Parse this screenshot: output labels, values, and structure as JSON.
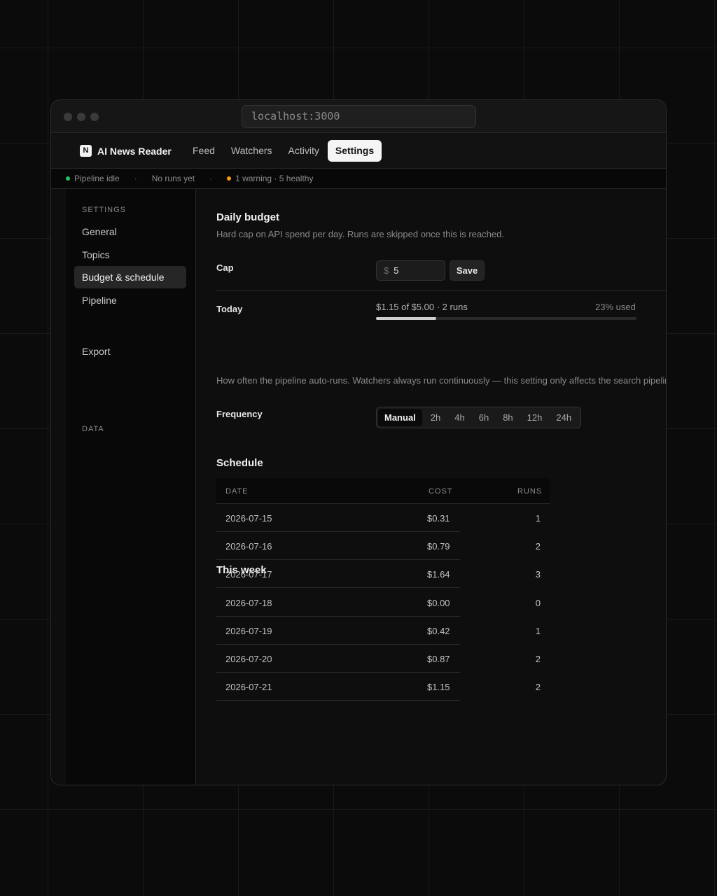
{
  "browser": {
    "url": "localhost:3000"
  },
  "app": {
    "name": "AI News Reader",
    "logo_letter": "N",
    "nav": [
      {
        "label": "Feed",
        "active": false
      },
      {
        "label": "Watchers",
        "active": false
      },
      {
        "label": "Activity",
        "active": false
      },
      {
        "label": "Settings",
        "active": true
      }
    ]
  },
  "status": {
    "pipeline": "Pipeline idle",
    "runs": "No runs yet",
    "health": "1 warning · 5 healthy",
    "colors": {
      "pipeline": "#22c55e",
      "health": "#f59e0b"
    }
  },
  "sidebar": {
    "section1": "SETTINGS",
    "items1": [
      "General",
      "Topics",
      "Budget & schedule",
      "Pipeline"
    ],
    "active_item": "Budget & schedule",
    "section2": "DATA",
    "items2": [
      "Export"
    ]
  },
  "budget": {
    "title": "Daily budget",
    "description": "Hard cap on API spend per day. Runs are skipped once this is reached.",
    "cap_label": "Cap",
    "currency": "$",
    "cap_value": "5",
    "save_label": "Save",
    "today_label": "Today",
    "today_text": "$1.15 of $5.00 · 2 runs",
    "used_text": "23% used",
    "used_fraction": 0.23
  },
  "schedule": {
    "title": "Schedule",
    "description": "How often the pipeline auto-runs. Watchers always run continuously — this setting only affects the search pipeline.",
    "frequency_label": "Frequency",
    "options": [
      "Manual",
      "2h",
      "4h",
      "6h",
      "8h",
      "12h",
      "24h"
    ],
    "selected": "Manual"
  },
  "week": {
    "title": "This week",
    "columns": [
      "DATE",
      "COST",
      "RUNS"
    ],
    "rows": [
      {
        "date": "2026-07-15",
        "cost": "$0.31",
        "runs": "1"
      },
      {
        "date": "2026-07-16",
        "cost": "$0.79",
        "runs": "2"
      },
      {
        "date": "2026-07-17",
        "cost": "$1.64",
        "runs": "3"
      },
      {
        "date": "2026-07-18",
        "cost": "$0.00",
        "runs": "0"
      },
      {
        "date": "2026-07-19",
        "cost": "$0.42",
        "runs": "1"
      },
      {
        "date": "2026-07-20",
        "cost": "$0.87",
        "runs": "2"
      },
      {
        "date": "2026-07-21",
        "cost": "$1.15",
        "runs": "2"
      }
    ]
  }
}
